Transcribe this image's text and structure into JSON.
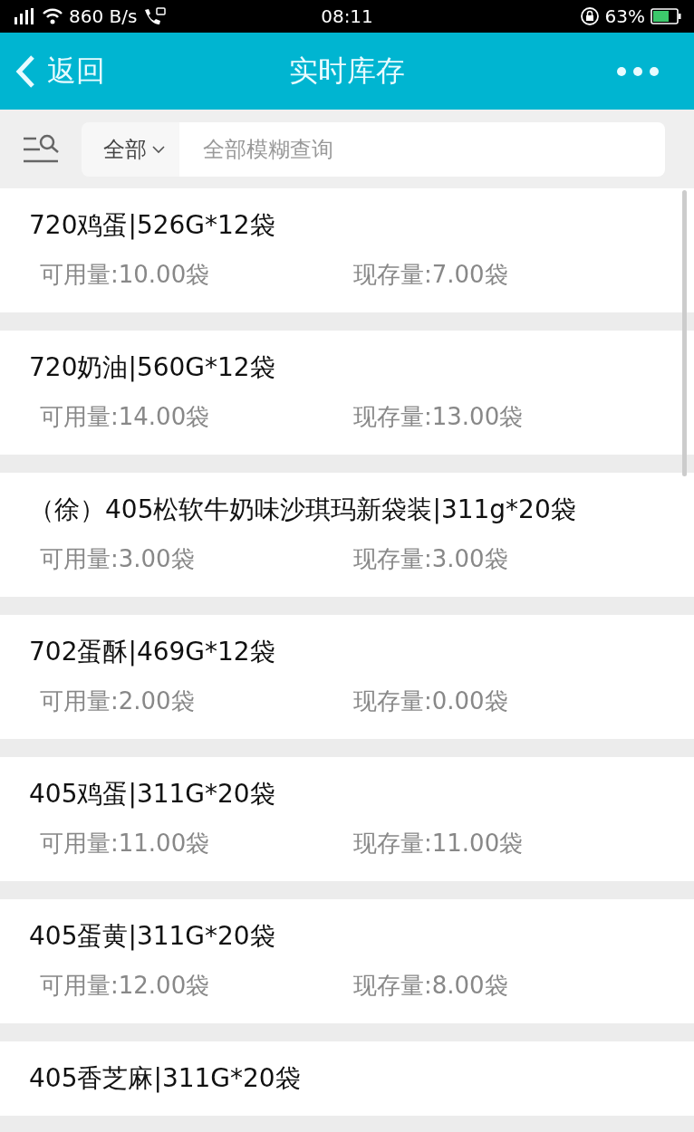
{
  "status_bar": {
    "speed": "860 B/s",
    "time": "08:11",
    "battery": "63%"
  },
  "header": {
    "back": "返回",
    "title": "实时库存"
  },
  "search": {
    "scope": "全部",
    "placeholder": "全部模糊查询"
  },
  "items": [
    {
      "name": "720鸡蛋|526G*12袋",
      "available": "可用量:10.00袋",
      "stock": "现存量:7.00袋"
    },
    {
      "name": "720奶油|560G*12袋",
      "available": "可用量:14.00袋",
      "stock": "现存量:13.00袋"
    },
    {
      "name": "（徐）405松软牛奶味沙琪玛新袋装|311g*20袋",
      "available": "可用量:3.00袋",
      "stock": "现存量:3.00袋"
    },
    {
      "name": "702蛋酥|469G*12袋",
      "available": "可用量:2.00袋",
      "stock": "现存量:0.00袋"
    },
    {
      "name": "405鸡蛋|311G*20袋",
      "available": "可用量:11.00袋",
      "stock": "现存量:11.00袋"
    },
    {
      "name": "405蛋黄|311G*20袋",
      "available": "可用量:12.00袋",
      "stock": "现存量:8.00袋"
    },
    {
      "name": "405香芝麻|311G*20袋"
    }
  ]
}
